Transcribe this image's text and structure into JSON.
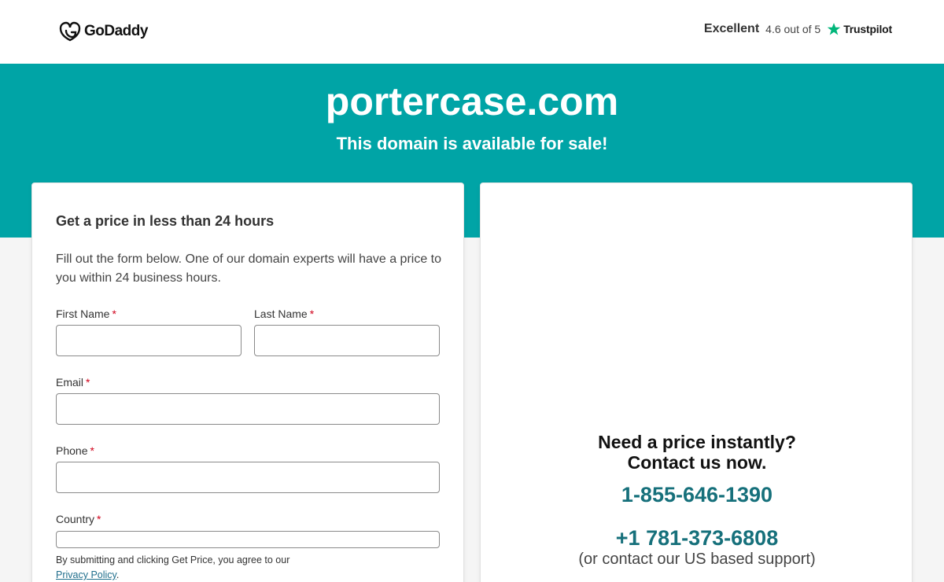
{
  "header": {
    "brand": "GoDaddy",
    "rating_word": "Excellent",
    "rating_score": "4.6 out of 5",
    "trustpilot": "Trustpilot",
    "accent_color": "#00b67a"
  },
  "hero": {
    "domain": "portercase.com",
    "tagline": "This domain is available for sale!",
    "background": "#00a4a6"
  },
  "form": {
    "title": "Get a price in less than 24 hours",
    "description": "Fill out the form below. One of our domain experts will have a price to you within 24 business hours.",
    "required_mark": "*",
    "fields": {
      "first_name": {
        "label": "First Name",
        "value": ""
      },
      "last_name": {
        "label": "Last Name",
        "value": ""
      },
      "email": {
        "label": "Email",
        "value": ""
      },
      "phone": {
        "label": "Phone",
        "value": ""
      },
      "country": {
        "label": "Country",
        "value": ""
      }
    },
    "legal_text": "By submitting and clicking Get Price, you agree to our",
    "privacy_link": "Privacy Policy",
    "legal_end": "."
  },
  "contact": {
    "heading_line1": "Need a price instantly?",
    "heading_line2": "Contact us now.",
    "phone_primary": "1-855-646-1390",
    "phone_secondary": "+1 781-373-6808",
    "support_note": "(or contact our US based support)",
    "phone_color": "#16707b"
  }
}
